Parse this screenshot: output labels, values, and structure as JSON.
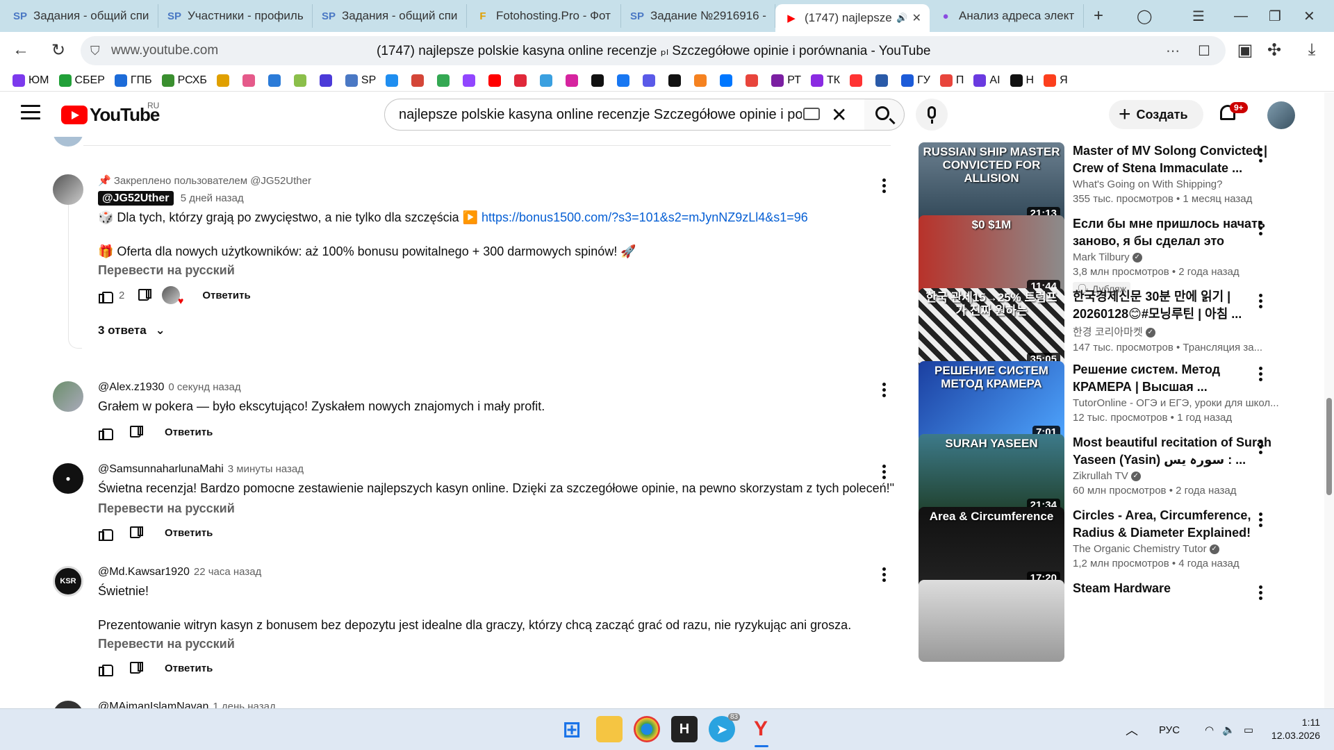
{
  "browser": {
    "tabs": [
      {
        "title": "Задания - общий спис",
        "fav": "SP",
        "color": "#4a78c4"
      },
      {
        "title": "Участники - профиль",
        "fav": "SP",
        "color": "#4a78c4"
      },
      {
        "title": "Задания - общий спис",
        "fav": "SP",
        "color": "#4a78c4"
      },
      {
        "title": "Fotohosting.Pro - Фот",
        "fav": "F",
        "color": "#e0a000"
      },
      {
        "title": "Задание №2916916 -",
        "fav": "SP",
        "color": "#4a78c4"
      },
      {
        "title": "(1747) najlepsze",
        "fav": "▶",
        "color": "#ff0000",
        "active": true
      },
      {
        "title": "Анализ адреса элект",
        "fav": "●",
        "color": "#8a4be0"
      }
    ],
    "url_host": "www.youtube.com",
    "url_title": "(1747) najlepsze polskie kasyna online recenzje ₚₗ Szczegółowe opinie i porównania - YouTube",
    "bookmarks": [
      {
        "label": "ЮМ",
        "color": "#7c3aed"
      },
      {
        "label": "СБЕР",
        "color": "#21a038"
      },
      {
        "label": "ГПБ",
        "color": "#1c6bd8"
      },
      {
        "label": "РСХБ",
        "color": "#3a8f2f"
      },
      {
        "label": "",
        "color": "#e0a000"
      },
      {
        "label": "",
        "color": "#e55a8a"
      },
      {
        "label": "",
        "color": "#2b7bd8"
      },
      {
        "label": "",
        "color": "#8bbf4a"
      },
      {
        "label": "",
        "color": "#4b3ad8"
      },
      {
        "label": "SP",
        "color": "#4a78c4"
      },
      {
        "label": "",
        "color": "#1f8ef0"
      },
      {
        "label": "",
        "color": "#d44638"
      },
      {
        "label": "",
        "color": "#34a853"
      },
      {
        "label": "",
        "color": "#9146ff"
      },
      {
        "label": "",
        "color": "#ff0000"
      },
      {
        "label": "",
        "color": "#e0283a"
      },
      {
        "label": "",
        "color": "#3aa0e0"
      },
      {
        "label": "",
        "color": "#d6249f"
      },
      {
        "label": "",
        "color": "#111111"
      },
      {
        "label": "",
        "color": "#1877f2"
      },
      {
        "label": "",
        "color": "#5a5ae8"
      },
      {
        "label": "",
        "color": "#111111"
      },
      {
        "label": "",
        "color": "#f58220"
      },
      {
        "label": "",
        "color": "#0077ff"
      },
      {
        "label": "",
        "color": "#e8453c"
      },
      {
        "label": "РТ",
        "color": "#7b1fa2"
      },
      {
        "label": "ТК",
        "color": "#8a2be2"
      },
      {
        "label": "",
        "color": "#ff3333"
      },
      {
        "label": "",
        "color": "#2a5aa8"
      },
      {
        "label": "ГУ",
        "color": "#1c5bd8"
      },
      {
        "label": "П",
        "color": "#e8453c"
      },
      {
        "label": "AI",
        "color": "#6a3ae0"
      },
      {
        "label": "Н",
        "color": "#111111"
      },
      {
        "label": "Я",
        "color": "#fc3f1d"
      }
    ]
  },
  "youtube": {
    "logo": "YouTube",
    "country": "RU",
    "search_query": "najlepsze polskie kasyna online recenzje Szczegółowe opinie i po",
    "create_label": "Создать",
    "notif_count": "9+"
  },
  "comments": {
    "pinned": {
      "pin_text": "Закреплено пользователем @JG52Uther",
      "author": "@JG52Uther",
      "time": "5 дней назад",
      "line1_prefix": "🎲 Dla tych, którzy grają po zwycięstwo, a nie tylko dla szczęścia ▶️ ",
      "line1_link": "https://bonus1500.com/?s3=101&s2=mJynNZ9zLl4&s1=96",
      "line2": "🎁 Oferta dla nowych użytkowników: aż 100% bonusu powitalnego + 300 darmowych spinów! 🚀",
      "translate": "Перевести на русский",
      "likes": "2",
      "reply": "Ответить",
      "replies_toggle": "3 ответа"
    },
    "list": [
      {
        "author": "@Alex.z1930",
        "time": "0 секунд назад",
        "text": "Grałem w pokera — było ekscytująco! Zyskałem nowych znajomych i mały profit.",
        "reply": "Ответить"
      },
      {
        "author": "@SamsunnaharlunaMahi",
        "time": "3 минуты назад",
        "text": "Świetna recenzja! Bardzo pomocne zestawienie najlepszych kasyn online. Dzięki za szczegółowe opinie, na pewno skorzystam z tych poleceń!\"",
        "translate": "Перевести на русский",
        "reply": "Ответить"
      },
      {
        "author": "@Md.Kawsar1920",
        "time": "22 часа назад",
        "text": "Świetnie!",
        "text2": "Prezentowanie witryn kasyn z bonusem bez depozytu jest idealne dla graczy, którzy chcą zacząć grać od razu, nie ryzykując ani grosza.",
        "translate": "Перевести на русский",
        "reply": "Ответить"
      },
      {
        "author": "@MAimanIslamNavan",
        "time": "1 день назад"
      }
    ]
  },
  "sidebar": [
    {
      "thumb_text": "RUSSIAN SHIP MASTER CONVICTED FOR ALLISION",
      "duration": "21:13",
      "title": "Master of MV Solong Convicted | Crew of Stena Immaculate ...",
      "channel": "What's Going on With Shipping?",
      "stats": "355 тыс. просмотров • 1 месяц назад",
      "bg": "linear-gradient(180deg,#6b7f8f,#2f4656)"
    },
    {
      "thumb_text": "$0  $1M",
      "duration": "11:44",
      "title": "Если бы мне пришлось начать заново, я бы сделал это",
      "channel": "Mark Tilbury",
      "verified": true,
      "stats": "3,8 млн просмотров • 2 года назад",
      "badge": "🗣 Дубляж",
      "bg": "linear-gradient(90deg,#b8322a,#8c8c8c)"
    },
    {
      "thumb_text": "한국 관세15→25% 트럼프가 진짜 원하는",
      "duration": "35:05",
      "title": "한국경제신문 30분 만에 읽기 | 20260128😊#모닝루틴 | 아침 ...",
      "channel": "한경 코리아마켓",
      "verified": true,
      "stats": "147 тыс. просмотров • Трансляция за...",
      "bg": "repeating-linear-gradient(45deg,#222 0 8px,#eee 8px 16px)"
    },
    {
      "thumb_text": "РЕШЕНИЕ СИСТЕМ МЕТОД КРАМЕРА",
      "duration": "7:01",
      "title": "Решение систем. Метод КРАМЕРА | Высшая ...",
      "channel": "TutorOnline - ОГЭ и ЕГЭ, уроки для школ...",
      "stats": "12 тыс. просмотров • 1 год назад",
      "bg": "linear-gradient(135deg,#1b3fa0,#4fa6ff)"
    },
    {
      "thumb_text": "SURAH YASEEN",
      "duration": "21:34",
      "title": "Most beautiful recitation of Surah Yaseen (Yasin) سورہ یس : ...",
      "channel": "Zikrullah TV",
      "verified": true,
      "stats": "60 млн просмотров • 2 года назад",
      "bg": "linear-gradient(180deg,#3d7a8a,#1f3f2a)"
    },
    {
      "thumb_text": "Area & Circumference",
      "duration": "17:20",
      "title": "Circles - Area, Circumference, Radius & Diameter Explained!",
      "channel": "The Organic Chemistry Tutor",
      "verified": true,
      "stats": "1,2 млн просмотров • 4 года назад",
      "bg": "linear-gradient(180deg,#111,#222)"
    },
    {
      "thumb_text": "",
      "duration": "",
      "title": "Steam Hardware",
      "channel": "",
      "stats": "",
      "bg": "linear-gradient(180deg,#ddd,#999)"
    }
  ],
  "taskbar": {
    "lang": "РУС",
    "time": "1:11",
    "date": "12.03.2026",
    "telegram_badge": "83"
  }
}
